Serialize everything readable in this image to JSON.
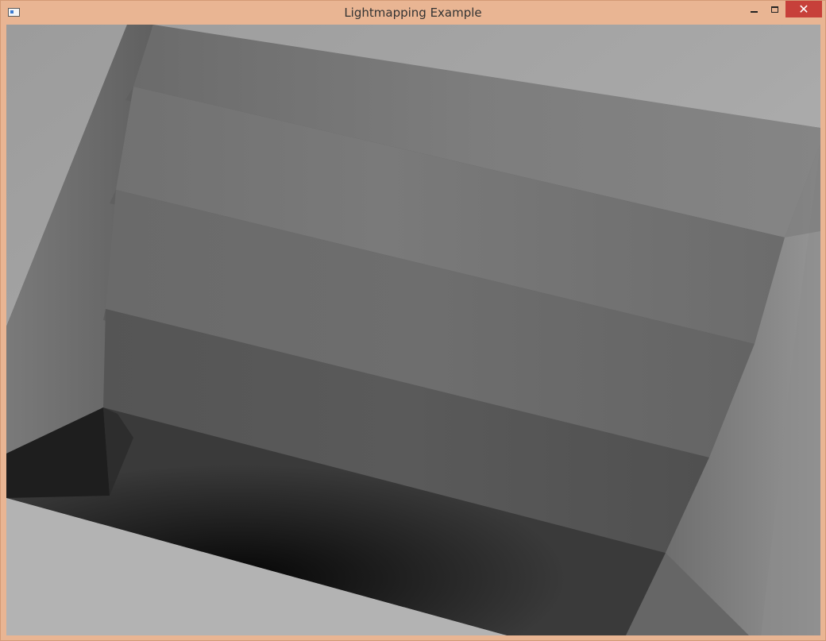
{
  "window": {
    "title": "Lightmapping Example",
    "accent_color": "#e9b593",
    "close_color": "#c7403a"
  },
  "controls": {
    "minimize_icon": "minimize-icon",
    "maximize_icon": "maximize-icon",
    "close_icon": "close-icon",
    "close_glyph": "✕"
  },
  "scene": {
    "description_icon": "3d-render-viewport"
  }
}
